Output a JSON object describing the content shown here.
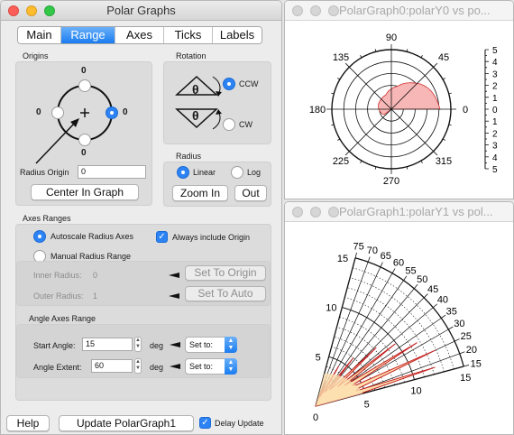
{
  "panel": {
    "title": "Polar Graphs",
    "tabs": [
      "Main",
      "Range",
      "Axes",
      "Ticks",
      "Labels"
    ],
    "origins": {
      "label": "Origins",
      "top_value": "0",
      "left_value": "0",
      "right_value": "0",
      "bottom_value": "0",
      "radius_origin_label": "Radius Origin",
      "radius_origin_value": "0",
      "center_button": "Center In Graph"
    },
    "rotation": {
      "label": "Rotation",
      "theta": "θ",
      "ccw_label": "CCW",
      "cw_label": "CW"
    },
    "radius": {
      "label": "Radius",
      "linear_label": "Linear",
      "log_label": "Log",
      "zoom_in_button": "Zoom In",
      "out_button": "Out"
    },
    "axes_ranges": {
      "label": "Axes Ranges",
      "autoscale_label": "Autoscale Radius Axes",
      "always_origin_label": "Always include Origin",
      "manual_label": "Manual Radius Range",
      "inner_label": "Inner Radius:",
      "inner_value": "0",
      "outer_label": "Outer Radius:",
      "outer_value": "1",
      "set_origin_button": "Set To Origin",
      "set_auto_button": "Set To Auto"
    },
    "angle_range": {
      "label": "Angle Axes Range",
      "start_label": "Start Angle:",
      "start_value": "15",
      "extent_label": "Angle Extent:",
      "extent_value": "60",
      "unit": "deg",
      "set_to_label": "Set to:"
    },
    "footer": {
      "help_button": "Help",
      "update_button": "Update PolarGraph1",
      "delay_label": "Delay Update"
    }
  },
  "graph0": {
    "title": "PolarGraph0:polarY0 vs po...",
    "angle_labels": [
      "90",
      "45",
      "0",
      "315",
      "270",
      "225",
      "180",
      "135"
    ],
    "radius_ticks": [
      "5",
      "4",
      "3",
      "2",
      "1",
      "0",
      "1",
      "2",
      "3",
      "4",
      "5"
    ],
    "colors": {
      "fill": "#f7b7b7",
      "line": "#d23232"
    }
  },
  "graph1": {
    "title": "PolarGraph1:polarY1 vs pol...",
    "angle_labels": [
      "75",
      "70",
      "65",
      "60",
      "55",
      "50",
      "45",
      "40",
      "35",
      "30",
      "25",
      "20",
      "15"
    ],
    "top_radius_label": "15",
    "left_radius_labels": [
      "10",
      "5"
    ],
    "bottom_radius_labels": [
      "5",
      "10",
      "15"
    ],
    "origin_label": "0",
    "colors": {
      "fill": "#fde0b0",
      "line": "#c42020"
    }
  }
}
